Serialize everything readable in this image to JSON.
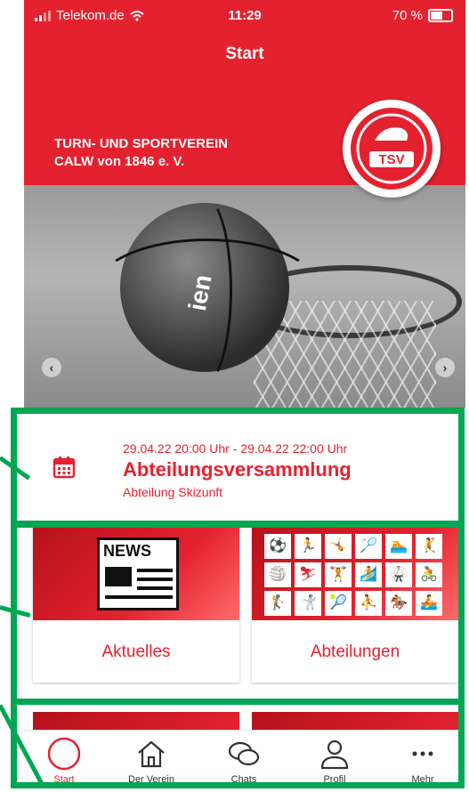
{
  "status": {
    "carrier": "Telekom.de",
    "time": "11:29",
    "battery": "70 %",
    "battery_level": 0.7
  },
  "header": {
    "title": "Start"
  },
  "hero": {
    "club_line1": "TURN- UND SPORTVEREIN",
    "club_line2": "CALW von 1846 e. V.",
    "logo_text": "TSV",
    "ball_text": "ien"
  },
  "event": {
    "datetime": "29.04.22 20:00 Uhr - 29.04.22 22:00 Uhr",
    "title": "Abteilungsversammlung",
    "department": "Abteilung Skizunft",
    "icon": "calendar-icon"
  },
  "tiles": [
    {
      "label": "Aktuelles",
      "image_text": "NEWS",
      "icon": "newspaper-icon"
    },
    {
      "label": "Abteilungen",
      "icon": "sports-pictograms"
    }
  ],
  "tabbar": [
    {
      "label": "Start",
      "icon": "circle-icon",
      "active": true
    },
    {
      "label": "Der Verein",
      "icon": "home-icon",
      "active": false
    },
    {
      "label": "Chats",
      "icon": "chat-icon",
      "active": false
    },
    {
      "label": "Profil",
      "icon": "user-icon",
      "active": false
    },
    {
      "label": "Mehr",
      "icon": "more-icon",
      "active": false
    }
  ],
  "colors": {
    "brand": "#e4222f",
    "annotation": "#00a651"
  }
}
